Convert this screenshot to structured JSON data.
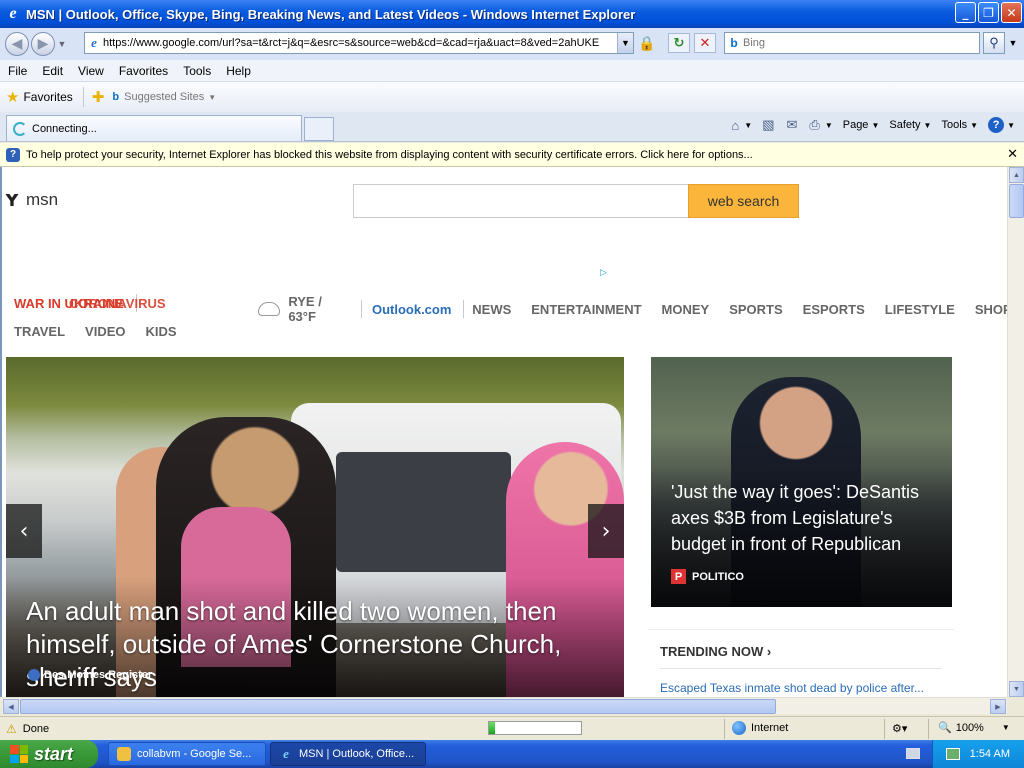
{
  "window": {
    "title": "MSN | Outlook, Office, Skype, Bing, Breaking News, and Latest Videos - Windows Internet Explorer",
    "minimize": "_",
    "restore": "❐",
    "close": "✕"
  },
  "address_bar": {
    "url": "https://www.google.com/url?sa=t&rct=j&q=&esrc=s&source=web&cd=&cad=rja&uact=8&ved=2ahUKE"
  },
  "search_bar": {
    "placeholder": "Bing"
  },
  "menu": [
    "File",
    "Edit",
    "View",
    "Favorites",
    "Tools",
    "Help"
  ],
  "favorites_bar": {
    "favorites_label": "Favorites",
    "suggested_sites": "Suggested Sites"
  },
  "tab": {
    "label": "Connecting..."
  },
  "command_bar": {
    "page": "Page",
    "safety": "Safety",
    "tools": "Tools",
    "help": "?"
  },
  "info_bar": {
    "message": "To help protect your security, Internet Explorer has blocked this website from displaying content with security certificate errors. Click here for options..."
  },
  "page": {
    "logo_text": "msn",
    "web_search_button": "web search",
    "nav_red_1": "WAR IN UKRAINE",
    "nav_red_2": "CORONAVIRUS",
    "weather": "RYE / 63°F",
    "outlook": "Outlook.com",
    "nav_row1": [
      "NEWS",
      "ENTERTAINMENT",
      "MONEY",
      "SPORTS",
      "ESPORTS",
      "LIFESTYLE",
      "SHOPPI"
    ],
    "nav_row2": [
      "TRAVEL",
      "VIDEO",
      "KIDS"
    ],
    "hero": {
      "headline": "An adult man shot and killed two women, then himself, outside of Ames' Cornerstone Church, sheriff says",
      "source": "Des Moines Register"
    },
    "side_story": {
      "headline": "'Just the way it goes': DeSantis axes $3B from Legislature's budget in front of Republican leaders",
      "source": "POLITICO"
    },
    "trending": {
      "header": "TRENDING NOW",
      "item1": "Escaped Texas inmate shot dead by police after..."
    }
  },
  "status_bar": {
    "status": "Done",
    "progress": 0.06,
    "zone": "Internet",
    "zoom": "100%"
  },
  "taskbar": {
    "start": "start",
    "task1": "collabvm - Google Se...",
    "task2": "MSN | Outlook, Office...",
    "time": "1:54 AM"
  },
  "colors": {
    "accent_orange": "#fbb53b",
    "nav_red": "#d83b2a",
    "link_blue": "#2a6db8"
  }
}
